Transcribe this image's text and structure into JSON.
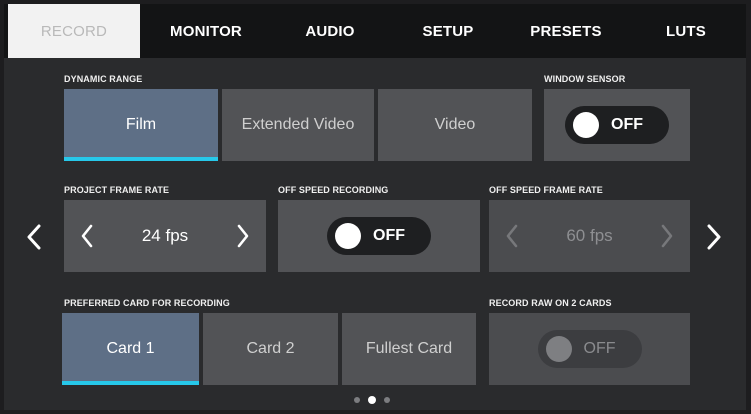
{
  "tabs": [
    {
      "label": "RECORD",
      "active": true
    },
    {
      "label": "MONITOR",
      "active": false
    },
    {
      "label": "AUDIO",
      "active": false
    },
    {
      "label": "SETUP",
      "active": false
    },
    {
      "label": "PRESETS",
      "active": false
    },
    {
      "label": "LUTS",
      "active": false
    }
  ],
  "dynamic_range": {
    "label": "DYNAMIC RANGE",
    "options": [
      "Film",
      "Extended Video",
      "Video"
    ],
    "selected": "Film"
  },
  "window_sensor": {
    "label": "WINDOW SENSOR",
    "state": "OFF"
  },
  "project_frame_rate": {
    "label": "PROJECT FRAME RATE",
    "value": "24 fps"
  },
  "off_speed_recording": {
    "label": "OFF SPEED RECORDING",
    "state": "OFF"
  },
  "off_speed_frame_rate": {
    "label": "OFF SPEED FRAME RATE",
    "value": "60 fps",
    "enabled": false
  },
  "preferred_card": {
    "label": "PREFERRED CARD FOR RECORDING",
    "options": [
      "Card 1",
      "Card 2",
      "Fullest Card"
    ],
    "selected": "Card 1"
  },
  "record_raw_2_cards": {
    "label": "RECORD RAW ON 2 CARDS",
    "state": "OFF",
    "enabled": false
  },
  "pagination": {
    "pages": 3,
    "current": 2
  },
  "colors": {
    "accent": "#27c8ea",
    "selected_bg": "#5e6f86",
    "button_bg": "#525356",
    "background": "#2a2b2d"
  }
}
